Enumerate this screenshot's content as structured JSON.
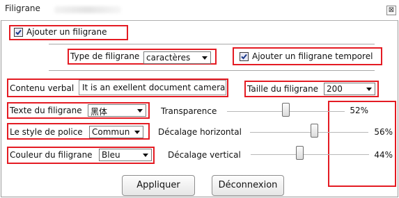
{
  "window": {
    "title": "Filigrane",
    "close_glyph": "⊠"
  },
  "add_watermark": {
    "label": "Ajouter un filigrane",
    "checked": true
  },
  "watermark_type": {
    "label": "Type de filigrane",
    "selected": "caractères"
  },
  "add_temporal_watermark": {
    "label": "Ajouter un filigrane temporel",
    "checked": true
  },
  "verbal_content": {
    "label": "Contenu verbal",
    "value": "It is an exellent document camera"
  },
  "watermark_size": {
    "label": "Taille du filigrane",
    "selected": "200"
  },
  "watermark_font": {
    "label": "Texte du filigrane",
    "selected": "黑体"
  },
  "font_style": {
    "label": "Le style de police",
    "selected": "Commun"
  },
  "watermark_color": {
    "label": "Couleur du filigrane",
    "selected": "Bleu"
  },
  "transparency": {
    "label": "Transparence",
    "value_text": "52%",
    "value": 52
  },
  "horizontal_offset": {
    "label": "Décalage horizontal",
    "value_text": "56%",
    "value": 56
  },
  "vertical_offset": {
    "label": "Décalage vertical",
    "value_text": "44%",
    "value": 44
  },
  "buttons": {
    "apply": "Appliquer",
    "disconnect": "Déconnexion"
  },
  "colors": {
    "annotation_red": "#e41b23",
    "check_bg": "#e8e8f4",
    "separator": "#a8a8a8"
  }
}
